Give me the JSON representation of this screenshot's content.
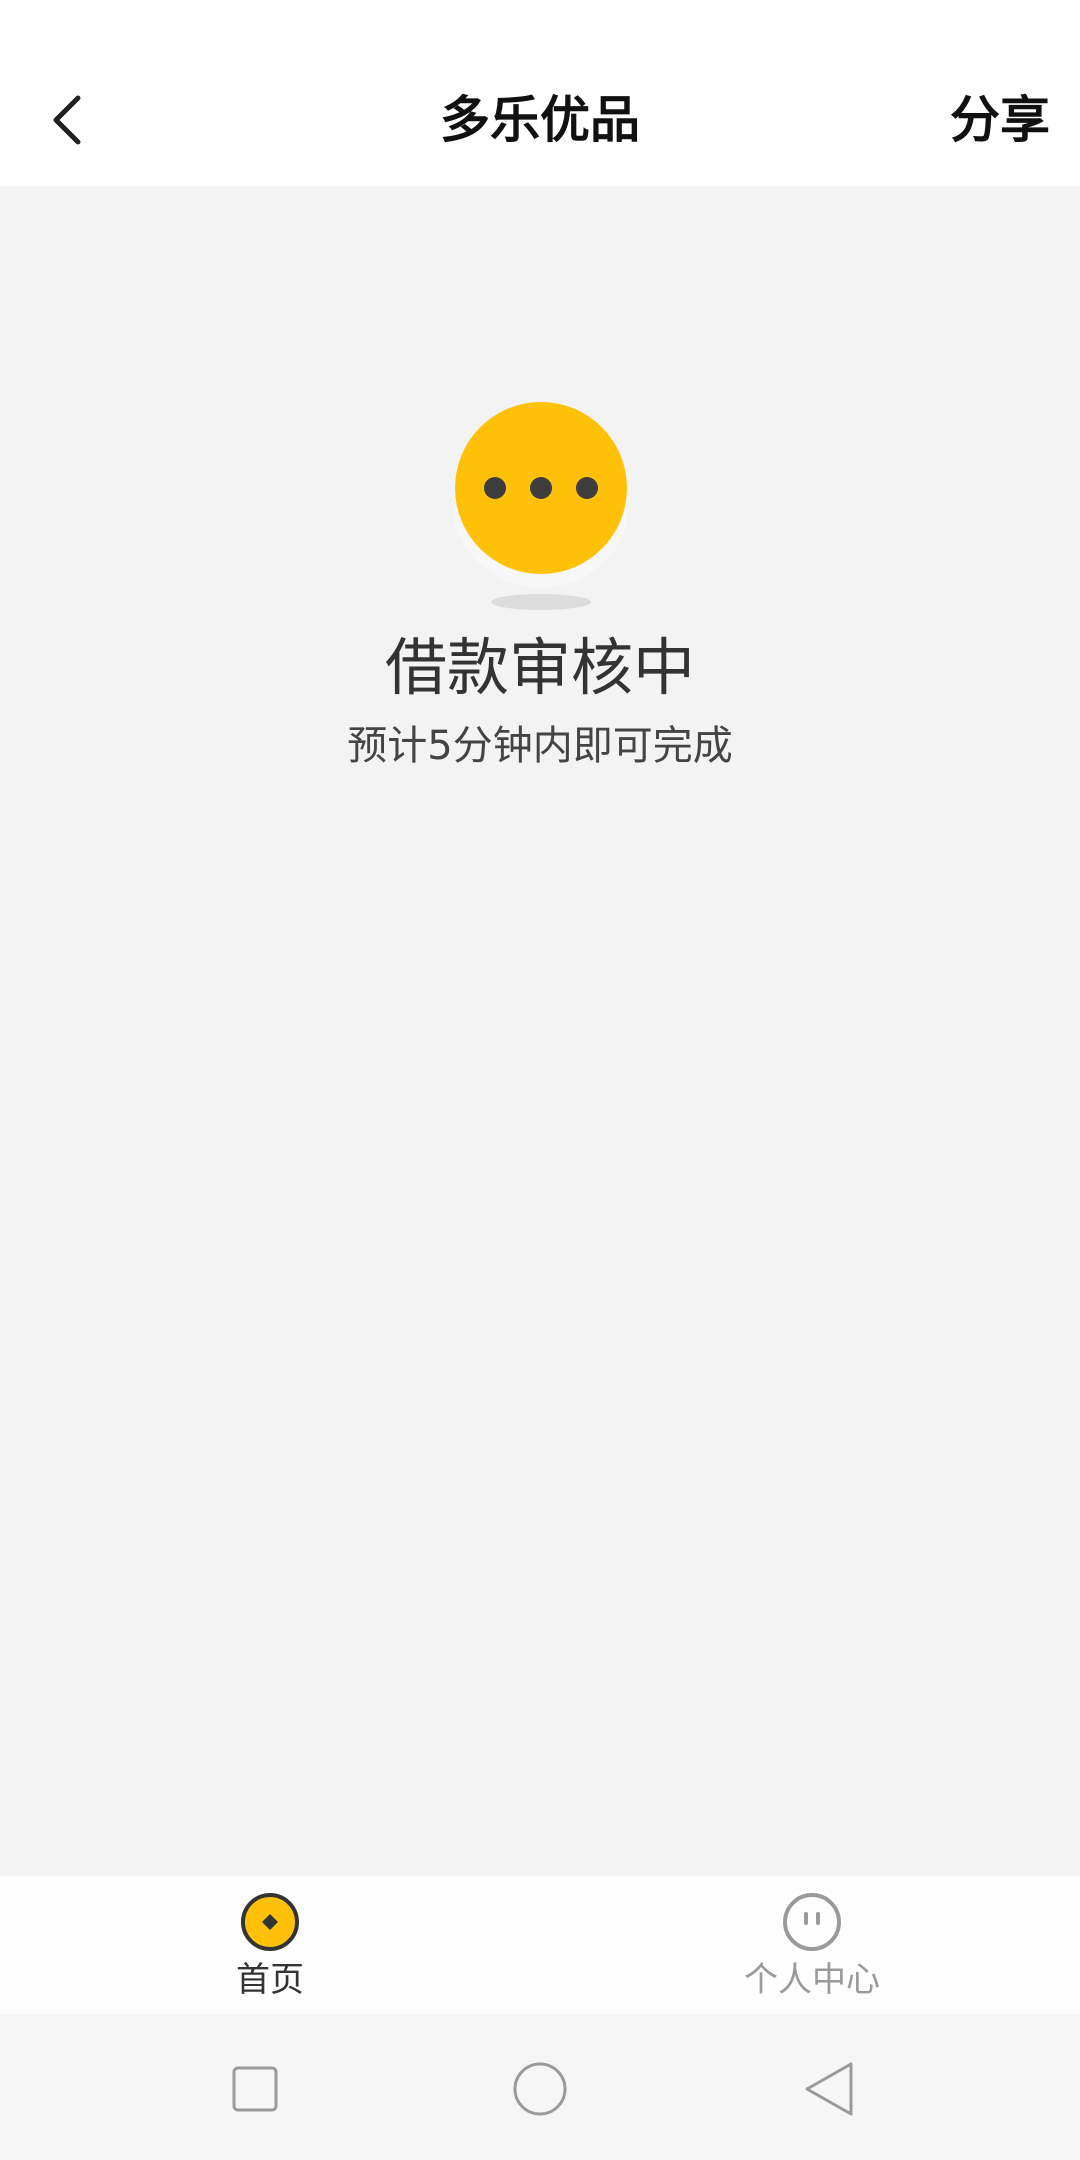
{
  "header": {
    "title": "多乐优品",
    "share_label": "分享",
    "back_icon": "chevron-left-icon"
  },
  "status": {
    "icon": "pending-dots-icon",
    "title": "借款审核中",
    "subtitle": "预计5分钟内即可完成",
    "accent_color": "#FFC107"
  },
  "tabbar": {
    "tabs": [
      {
        "label": "首页",
        "icon": "coin-icon",
        "active": true
      },
      {
        "label": "个人中心",
        "icon": "face-icon",
        "active": false
      }
    ]
  },
  "system_nav": {
    "buttons": [
      "recent-apps-icon",
      "home-circle-icon",
      "back-triangle-icon"
    ]
  }
}
